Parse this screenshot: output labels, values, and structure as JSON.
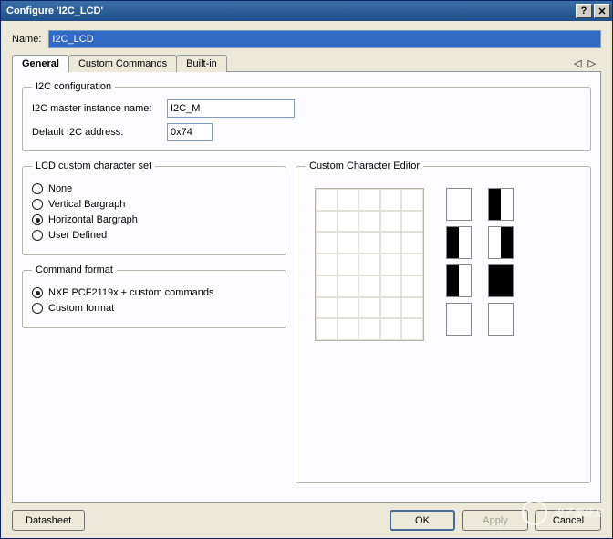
{
  "window": {
    "title": "Configure 'I2C_LCD'"
  },
  "name_field": {
    "label": "Name:",
    "value": "I2C_LCD"
  },
  "tabs": {
    "general": "General",
    "custom_commands": "Custom Commands",
    "builtin": "Built-in",
    "nav": "◁ ▷"
  },
  "i2c_config": {
    "legend": "I2C configuration",
    "master_label": "I2C master instance name:",
    "master_value": "I2C_M",
    "addr_label": "Default I2C address:",
    "addr_value": "0x74"
  },
  "charset": {
    "legend": "LCD custom character set",
    "options": {
      "none": "None",
      "vbar": "Vertical Bargraph",
      "hbar": "Horizontal Bargraph",
      "user": "User Defined"
    },
    "selected": "hbar"
  },
  "cmdformat": {
    "legend": "Command format",
    "options": {
      "nxp": "NXP PCF2119x + custom commands",
      "custom": "Custom format"
    },
    "selected": "nxp"
  },
  "editor": {
    "legend": "Custom Character Editor"
  },
  "buttons": {
    "datasheet": "Datasheet",
    "ok": "OK",
    "apply": "Apply",
    "cancel": "Cancel"
  },
  "watermark": "电子发烧友"
}
